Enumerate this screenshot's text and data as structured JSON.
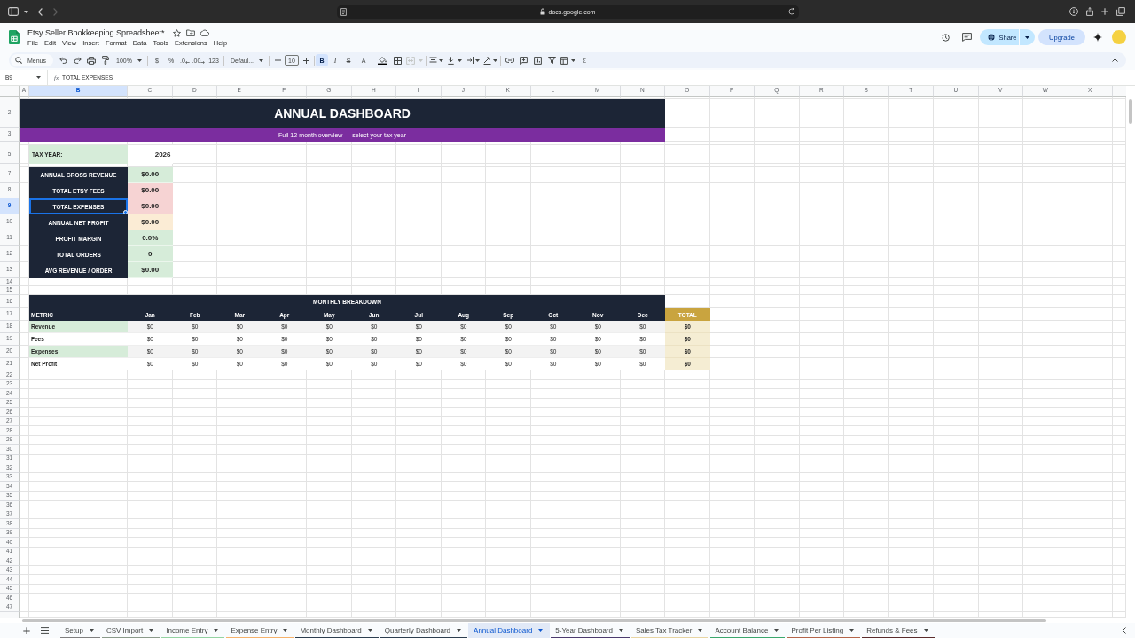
{
  "browser": {
    "url": "docs.google.com",
    "forward": {
      "disabled": true
    }
  },
  "document": {
    "title": "Etsy Seller Bookkeeping Spreadsheet*",
    "menus": [
      "File",
      "Edit",
      "View",
      "Insert",
      "Format",
      "Data",
      "Tools",
      "Extensions",
      "Help"
    ],
    "share": "Share",
    "upgrade": "Upgrade"
  },
  "toolbar": {
    "search": {
      "placeholder": "Menus"
    },
    "zoom": "100%",
    "currency": "$",
    "percent": "%",
    "decrease_decimal": ".0",
    "increase_decimal": ".00",
    "more_formats": "123",
    "font": "Defaul...",
    "font_size": "10",
    "bold": {
      "label": "B",
      "on": true
    },
    "italic": "I",
    "strikethrough": "S",
    "text_color": "A",
    "merge": {
      "disabled": true
    },
    "functions": "Σ"
  },
  "formula_bar": {
    "cell": "B9",
    "function_label": "fx",
    "formula": "TOTAL EXPENSES"
  },
  "columns": [
    {
      "label": "A",
      "selected": false
    },
    {
      "label": "B",
      "selected": true
    },
    {
      "label": "C",
      "selected": false
    },
    {
      "label": "D",
      "selected": false
    },
    {
      "label": "E",
      "selected": false
    },
    {
      "label": "F",
      "selected": false
    },
    {
      "label": "G",
      "selected": false
    },
    {
      "label": "H",
      "selected": false
    },
    {
      "label": "I",
      "selected": false
    },
    {
      "label": "J",
      "selected": false
    },
    {
      "label": "K",
      "selected": false
    },
    {
      "label": "L",
      "selected": false
    },
    {
      "label": "M",
      "selected": false
    },
    {
      "label": "N",
      "selected": false
    },
    {
      "label": "O",
      "selected": false
    },
    {
      "label": "P",
      "selected": false
    },
    {
      "label": "Q",
      "selected": false
    },
    {
      "label": "R",
      "selected": false
    },
    {
      "label": "S",
      "selected": false
    },
    {
      "label": "T",
      "selected": false
    },
    {
      "label": "U",
      "selected": false
    },
    {
      "label": "V",
      "selected": false
    },
    {
      "label": "W",
      "selected": false
    },
    {
      "label": "X",
      "selected": false
    }
  ],
  "rows": [
    {
      "label": "2",
      "selected": false
    },
    {
      "label": "3",
      "selected": false
    },
    {
      "label": "5",
      "selected": false
    },
    {
      "label": "7",
      "selected": false
    },
    {
      "label": "8",
      "selected": false
    },
    {
      "label": "9",
      "selected": true
    },
    {
      "label": "10",
      "selected": false
    },
    {
      "label": "11",
      "selected": false
    },
    {
      "label": "12",
      "selected": false
    },
    {
      "label": "13",
      "selected": false
    },
    {
      "label": "14",
      "selected": false
    },
    {
      "label": "15",
      "selected": false
    },
    {
      "label": "16",
      "selected": false
    },
    {
      "label": "17",
      "selected": false
    },
    {
      "label": "18",
      "selected": false
    },
    {
      "label": "19",
      "selected": false
    },
    {
      "label": "20",
      "selected": false
    },
    {
      "label": "21",
      "selected": false
    },
    {
      "label": "22",
      "selected": false
    },
    {
      "label": "23",
      "selected": false
    },
    {
      "label": "24",
      "selected": false
    },
    {
      "label": "25",
      "selected": false
    },
    {
      "label": "26",
      "selected": false
    },
    {
      "label": "27",
      "selected": false
    },
    {
      "label": "28",
      "selected": false
    },
    {
      "label": "29",
      "selected": false
    },
    {
      "label": "30",
      "selected": false
    },
    {
      "label": "31",
      "selected": false
    },
    {
      "label": "32",
      "selected": false
    },
    {
      "label": "33",
      "selected": false
    },
    {
      "label": "34",
      "selected": false
    },
    {
      "label": "35",
      "selected": false
    },
    {
      "label": "36",
      "selected": false
    },
    {
      "label": "37",
      "selected": false
    },
    {
      "label": "38",
      "selected": false
    },
    {
      "label": "39",
      "selected": false
    },
    {
      "label": "40",
      "selected": false
    },
    {
      "label": "41",
      "selected": false
    },
    {
      "label": "42",
      "selected": false
    },
    {
      "label": "43",
      "selected": false
    },
    {
      "label": "44",
      "selected": false
    },
    {
      "label": "45",
      "selected": false
    },
    {
      "label": "46",
      "selected": false
    },
    {
      "label": "47",
      "selected": false
    }
  ],
  "dashboard": {
    "title": "ANNUAL DASHBOARD",
    "subtitle": "Full 12-month overview — select your tax year",
    "tax_year": {
      "label": "TAX YEAR:",
      "value": "2026"
    },
    "kpis": [
      {
        "label": "ANNUAL GROSS REVENUE",
        "value": "$0.00",
        "color": "#d6ecd9",
        "selected": false
      },
      {
        "label": "TOTAL ETSY FEES",
        "value": "$0.00",
        "color": "#f6d3d3",
        "selected": false
      },
      {
        "label": "TOTAL EXPENSES",
        "value": "$0.00",
        "color": "#f6d3d3",
        "selected": true
      },
      {
        "label": "ANNUAL NET PROFIT",
        "value": "$0.00",
        "color": "#fbecd5",
        "selected": false
      },
      {
        "label": "PROFIT MARGIN",
        "value": "0.0%",
        "color": "#d6ecd9",
        "selected": false
      },
      {
        "label": "TOTAL ORDERS",
        "value": "0",
        "color": "#d6ecd9",
        "selected": false
      },
      {
        "label": "AVG REVENUE / ORDER",
        "value": "$0.00",
        "color": "#d6ecd9",
        "selected": false
      }
    ],
    "monthly": {
      "title": "MONTHLY BREAKDOWN",
      "metric_header": "METRIC",
      "months": [
        "Jan",
        "Feb",
        "Mar",
        "Apr",
        "May",
        "Jun",
        "Jul",
        "Aug",
        "Sep",
        "Oct",
        "Nov",
        "Dec"
      ],
      "total_header": "TOTAL",
      "rows": [
        {
          "metric": "Revenue",
          "values": [
            "$0",
            "$0",
            "$0",
            "$0",
            "$0",
            "$0",
            "$0",
            "$0",
            "$0",
            "$0",
            "$0",
            "$0"
          ],
          "total": "$0"
        },
        {
          "metric": "Fees",
          "values": [
            "$0",
            "$0",
            "$0",
            "$0",
            "$0",
            "$0",
            "$0",
            "$0",
            "$0",
            "$0",
            "$0",
            "$0"
          ],
          "total": "$0"
        },
        {
          "metric": "Expenses",
          "values": [
            "$0",
            "$0",
            "$0",
            "$0",
            "$0",
            "$0",
            "$0",
            "$0",
            "$0",
            "$0",
            "$0",
            "$0"
          ],
          "total": "$0"
        },
        {
          "metric": "Net Profit",
          "values": [
            "$0",
            "$0",
            "$0",
            "$0",
            "$0",
            "$0",
            "$0",
            "$0",
            "$0",
            "$0",
            "$0",
            "$0"
          ],
          "total": "$0"
        }
      ]
    }
  },
  "sheet_tabs": [
    {
      "label": "Setup",
      "selected": false,
      "color": "#7f7f7f"
    },
    {
      "label": "CSV Import",
      "selected": false,
      "color": "#8a9a8a"
    },
    {
      "label": "Income Entry",
      "selected": false,
      "color": "#93d3a2"
    },
    {
      "label": "Expense Entry",
      "selected": false,
      "color": "#f6b26b"
    },
    {
      "label": "Monthly Dashboard",
      "selected": false,
      "color": "#2c3e50"
    },
    {
      "label": "Quarterly Dashboard",
      "selected": false,
      "color": "#2c3e50"
    },
    {
      "label": "Annual Dashboard",
      "selected": true
    },
    {
      "label": "5-Year Dashboard",
      "selected": false,
      "color": "#4b3a6e"
    },
    {
      "label": "Sales Tax Tracker",
      "selected": false,
      "color": "#e8d5a3"
    },
    {
      "label": "Account Balance",
      "selected": false,
      "color": "#3aa76d"
    },
    {
      "label": "Profit Per Listing",
      "selected": false,
      "color": "#b4654a"
    },
    {
      "label": "Refunds & Fees",
      "selected": false,
      "color": "#5b2c2c"
    }
  ]
}
